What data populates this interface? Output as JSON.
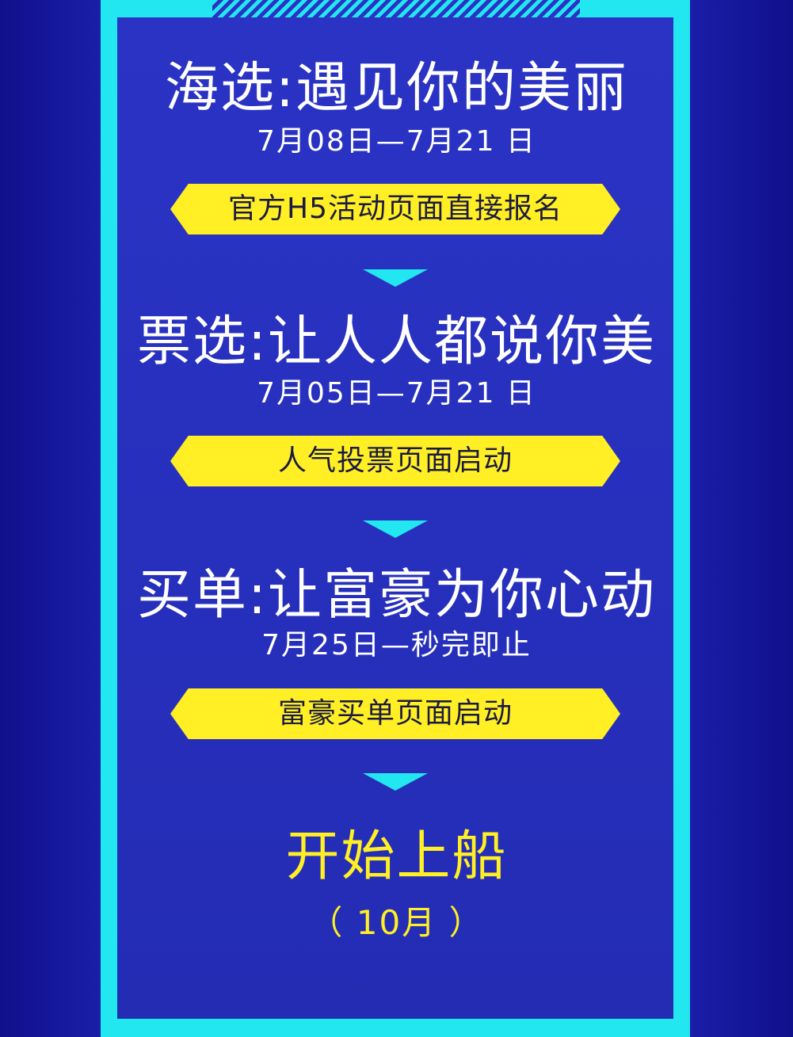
{
  "colors": {
    "background": "#12129a",
    "frame": "#22e6f0",
    "panel": "#2a33c4",
    "tag": "#ffef24",
    "highlight": "#ffef24"
  },
  "stages": [
    {
      "title": "海选:遇见你的美丽",
      "dates": "7月08日—7月21 日",
      "tag": "官方H5活动页面直接报名"
    },
    {
      "title": "票选:让人人都说你美",
      "dates": "7月05日—7月21 日",
      "tag": "人气投票页面启动"
    },
    {
      "title": "买单:让富豪为你心动",
      "dates": "7月25日—秒完即止",
      "tag": "富豪买单页面启动"
    }
  ],
  "final": {
    "title": "开始上船",
    "subtitle": "（ 10月 ）"
  },
  "icons": {
    "arrow": "chevron-down-icon"
  }
}
